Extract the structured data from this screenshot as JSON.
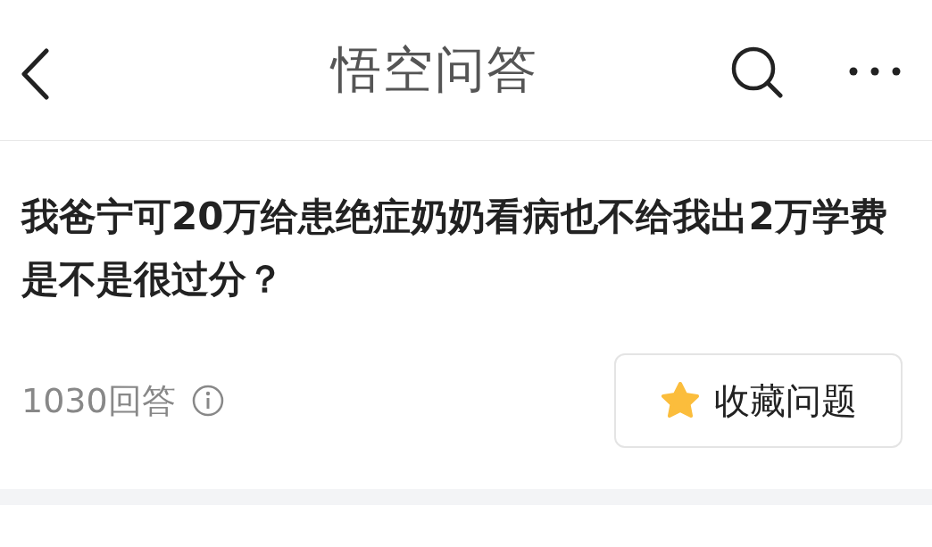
{
  "header": {
    "title": "悟空问答"
  },
  "question": {
    "title": "我爸宁可20万给患绝症奶奶看病也不给我出2万学费是不是很过分？",
    "answer_count": "1030回答"
  },
  "favorite_button": {
    "label": "收藏问题",
    "selected": false
  }
}
